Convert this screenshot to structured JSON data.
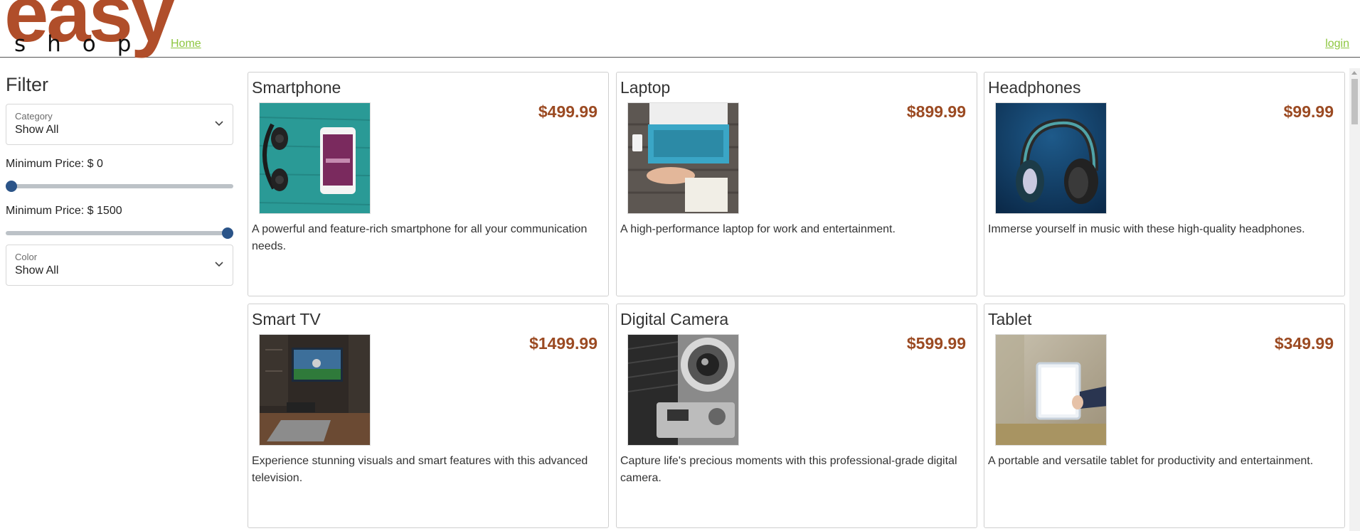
{
  "header": {
    "logo_top": "easy",
    "logo_bottom": "shop",
    "home_label": "Home",
    "login_label": "login"
  },
  "filter": {
    "title": "Filter",
    "category": {
      "label": "Category",
      "value": "Show All"
    },
    "min_price": {
      "label": "Minimum Price: $ 0",
      "value": 0
    },
    "max_price": {
      "label": "Minimum Price: $ 1500",
      "value": 1500
    },
    "price_range": [
      0,
      1500
    ],
    "color": {
      "label": "Color",
      "value": "Show All"
    }
  },
  "products": [
    {
      "name": "Smartphone",
      "price": "$499.99",
      "description": "A powerful and feature-rich smartphone for all your communication needs.",
      "image_icon": "smartphone-photo"
    },
    {
      "name": "Laptop",
      "price": "$899.99",
      "description": "A high-performance laptop for work and entertainment.",
      "image_icon": "laptop-photo"
    },
    {
      "name": "Headphones",
      "price": "$99.99",
      "description": "Immerse yourself in music with these high-quality headphones.",
      "image_icon": "headphones-photo"
    },
    {
      "name": "Smart TV",
      "price": "$1499.99",
      "description": "Experience stunning visuals and smart features with this advanced television.",
      "image_icon": "smart-tv-photo"
    },
    {
      "name": "Digital Camera",
      "price": "$599.99",
      "description": "Capture life's precious moments with this professional-grade digital camera.",
      "image_icon": "camera-photo"
    },
    {
      "name": "Tablet",
      "price": "$349.99",
      "description": "A portable and versatile tablet for productivity and entertainment.",
      "image_icon": "tablet-photo"
    }
  ],
  "colors": {
    "brand": "#b04e2a",
    "link": "#8dc63f",
    "price": "#9b4a22",
    "slider_thumb": "#2b5488"
  }
}
